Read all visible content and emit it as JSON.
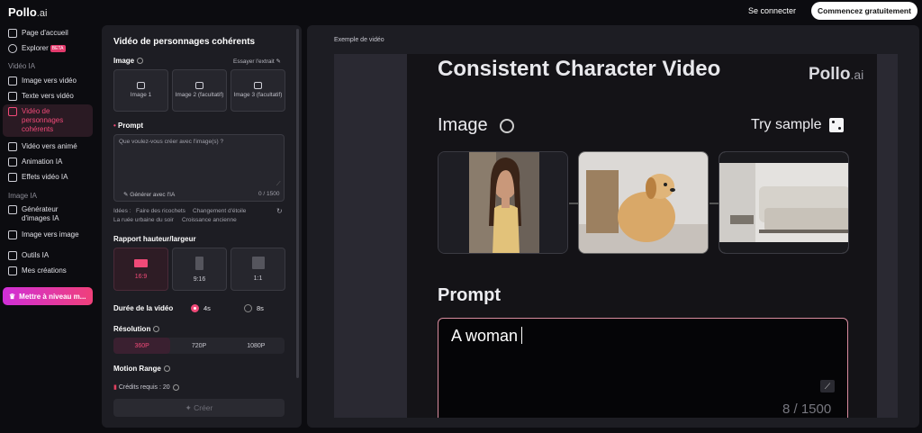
{
  "header": {
    "logo": "Pollo",
    "logo_suffix": ".ai",
    "signin": "Se connecter",
    "start": "Commencez gratuitement"
  },
  "sidebar": {
    "home": "Page d'accueil",
    "explore": "Explorer",
    "explore_badge": "BETA",
    "video_section": "Vidéo IA",
    "video_items": [
      "Image vers vidéo",
      "Texte vers vidéo",
      "Vidéo de personnages cohérents",
      "Vidéo vers animé",
      "Animation IA",
      "Effets vidéo IA"
    ],
    "image_section": "Image IA",
    "image_items": [
      "Générateur d'images IA",
      "Image vers image"
    ],
    "tools": "Outils IA",
    "creations": "Mes créations",
    "upgrade": "Mettre à niveau m..."
  },
  "panel": {
    "title": "Vidéo de personnages cohérents",
    "image_label": "Image",
    "try_sample": "Essayer l'extrait",
    "image_slots": [
      "Image 1",
      "Image 2 (facultatif)",
      "Image 3 (facultatif)"
    ],
    "prompt_label": "Prompt",
    "prompt_placeholder": "Que voulez-vous créer avec l'image(s) ?",
    "generate_ai": "Générer avec l'IA",
    "char_count": "0 / 1500",
    "ideas_label": "Idées :",
    "ideas": [
      "Faire des ricochets",
      "Changement d'étoile",
      "La ruée urbaine du soir",
      "Croissance ancienne"
    ],
    "ratio_label": "Rapport hauteur/largeur",
    "ratios": [
      "16:9",
      "9:16",
      "1:1"
    ],
    "duration_label": "Durée de la vidéo",
    "durations": [
      "4s",
      "8s"
    ],
    "resolution_label": "Résolution",
    "resolutions": [
      "360P",
      "720P",
      "1080P"
    ],
    "motion_label": "Motion Range",
    "credits": "Crédits requis : 20",
    "create": "Créer"
  },
  "preview": {
    "label": "Exemple de vidéo",
    "title": "Consistent Character Video",
    "logo": "Pollo",
    "logo_suffix": ".ai",
    "image_label": "Image",
    "try_sample": "Try sample",
    "prompt_label": "Prompt",
    "prompt_text": "A woman",
    "count": "8 / 1500"
  },
  "colors": {
    "accent": "#f04a78",
    "panel": "#1d1d23",
    "background": "#0c0c10"
  }
}
